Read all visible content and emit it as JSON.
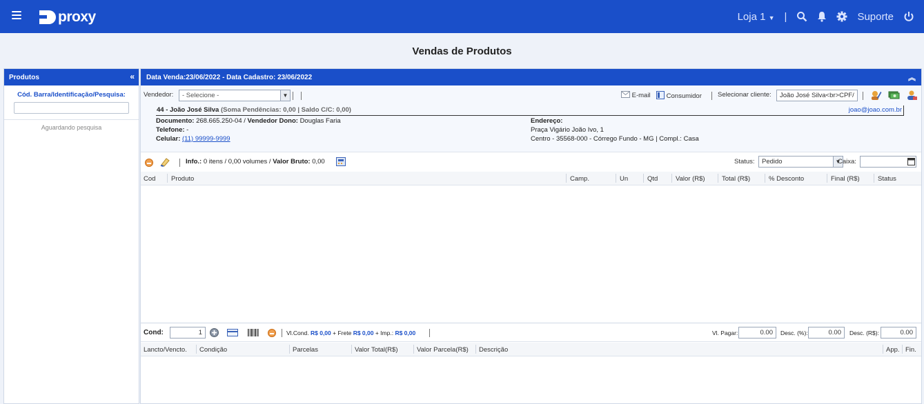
{
  "header": {
    "logo": "proxy",
    "store": "Loja 1",
    "support": "Suporte"
  },
  "page_title": "Vendas de Produtos",
  "left_panel": {
    "title": "Produtos",
    "search_label": "Cód. Barra/Identificação/Pesquisa:",
    "search_value": "",
    "waiting": "Aguardando pesquisa"
  },
  "main": {
    "title": "Data Venda:23/06/2022 - Data Cadastro: 23/06/2022",
    "vendor_label": "Vendedor:",
    "vendor_value": "- Selecione -",
    "email_label": "E-mail",
    "consumer_label": "Consumidor",
    "select_client_label": "Selecionar cliente:",
    "select_client_value": "João José Silva<br>CPF/",
    "client": {
      "name": "44 - João José Silva",
      "pending": "(Soma Pendências: 0,00 | Saldo C/C: 0,00)",
      "email": "joao@joao.com.br",
      "document_label": "Documento:",
      "document_value": "268.665.250-04 /",
      "owner_label": "Vendedor Dono:",
      "owner_value": "Douglas Faria",
      "phone_label": "Telefone:",
      "phone_value": "-",
      "cell_label": "Celular:",
      "cell_value": "(11) 99999-9999",
      "address_label": "Endereço:",
      "address_line1": "Praça Vigário João Ivo, 1",
      "address_line2": "Centro - 35568-000 - Córrego Fundo - MG | Compl.: Casa"
    },
    "info_label": "Info.:",
    "info_value": "0 itens / 0,00 volumes /",
    "gross_label": "Valor Bruto:",
    "gross_value": "0,00",
    "status_label": "Status:",
    "status_value": "Pedido",
    "cashier_label": "Caixa:",
    "cashier_value": "",
    "columns": [
      "Cod",
      "Produto",
      "Camp.",
      "Un",
      "Qtd",
      "Valor (R$)",
      "Total (R$)",
      "% Desconto",
      "Final (R$)",
      "Status"
    ],
    "cond_label": "Cond:",
    "cond_value": "1",
    "vlcond_label": "Vl.Cond.",
    "vlcond_value": "R$ 0,00",
    "frete_label": "+ Frete",
    "frete_value": "R$ 0,00",
    "imp_label": "+ Imp.:",
    "imp_value": "R$ 0,00",
    "pay_label": "Vl. Pagar:",
    "pay_value": "0.00",
    "desc_pct_label": "Desc. (%):",
    "desc_pct_value": "0.00",
    "desc_rs_label": "Desc. (R$):",
    "desc_rs_value": "0.00",
    "columns2": [
      "Lancto/Vencto.",
      "Condição",
      "Parcelas",
      "Valor Total(R$)",
      "Valor Parcela(R$)",
      "Descrição",
      "App.",
      "Fin."
    ]
  },
  "colors": {
    "primary": "#1a4fc9",
    "background": "#eef2f9"
  }
}
